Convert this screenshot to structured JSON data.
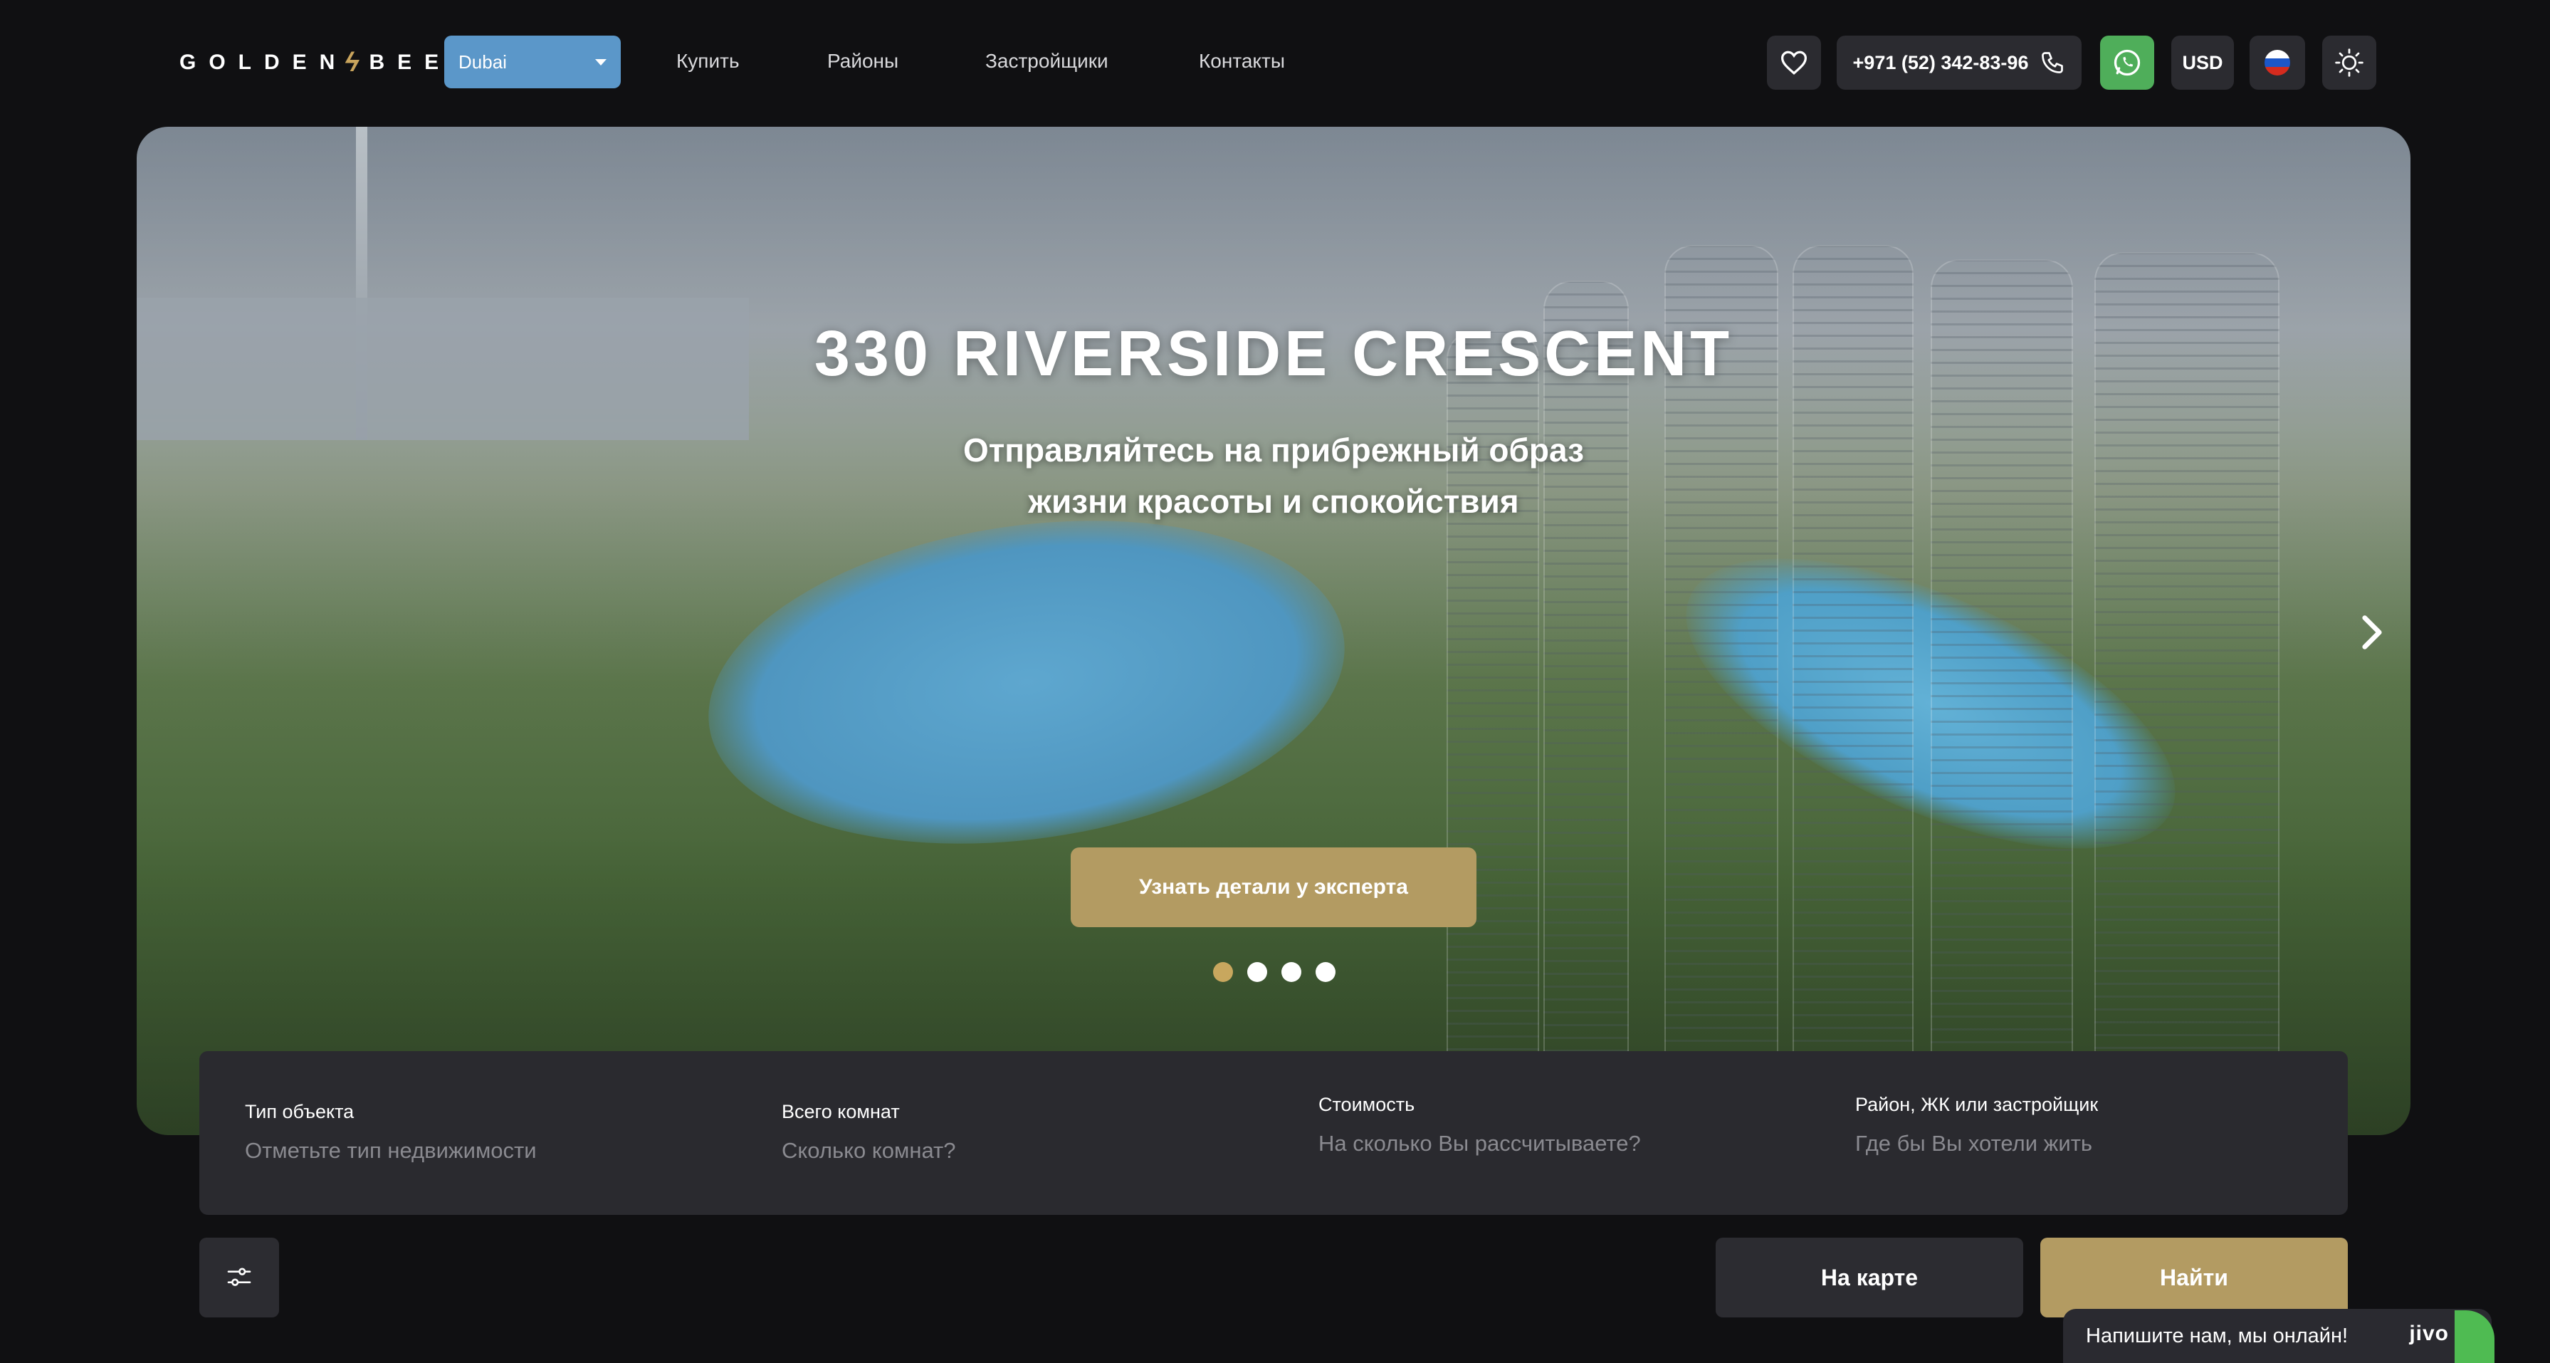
{
  "header": {
    "logo_text": "GOLDEN BEE",
    "logo_left": "GOLDEN",
    "logo_right": "BEE",
    "city_select": {
      "value": "Dubai"
    },
    "nav": [
      {
        "label": "Купить"
      },
      {
        "label": "Районы"
      },
      {
        "label": "Застройщики"
      },
      {
        "label": "Контакты"
      }
    ],
    "phone": "+971 (52) 342-83-96",
    "currency": "USD",
    "icons": {
      "favorites": "heart-icon",
      "phone": "phone-icon",
      "whatsapp": "whatsapp-icon",
      "language": "russian-flag-icon",
      "theme": "sun-icon"
    }
  },
  "hero": {
    "title": "330 RIVERSIDE CRESCENT",
    "subtitle_line1": "Отправляйтесь на прибрежный образ",
    "subtitle_line2": "жизни красоты и спокойствия",
    "cta_label": "Узнать детали у эксперта",
    "slides_total": 4,
    "active_slide": 1
  },
  "search": {
    "fields": [
      {
        "label": "Тип объекта",
        "placeholder": "Отметьте тип недвижимости"
      },
      {
        "label": "Всего комнат",
        "placeholder": "Сколько комнат?"
      },
      {
        "label": "Стоимость",
        "placeholder": "На сколько Вы рассчитываете?"
      },
      {
        "label": "Район, ЖК или застройщик",
        "placeholder": "Где бы Вы хотели жить"
      }
    ]
  },
  "actions": {
    "map_label": "На карте",
    "find_label": "Найти"
  },
  "chat": {
    "text": "Напишите нам, мы онлайн!",
    "brand": "jivo"
  },
  "colors": {
    "background": "#101012",
    "gold": "#b39b62",
    "city_select": "#5b97c9",
    "whatsapp": "#4fae5a",
    "panel": "#2a2a2f"
  }
}
